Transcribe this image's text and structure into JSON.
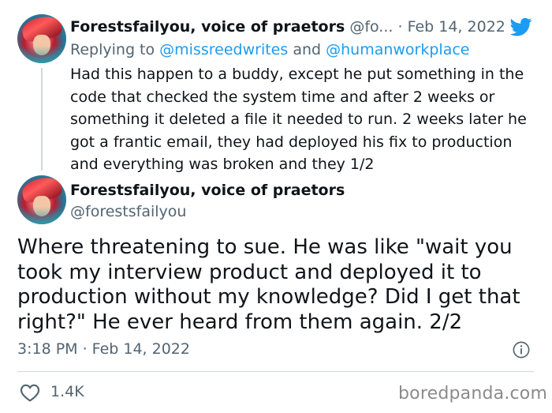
{
  "reply_tweet": {
    "display_name": "Forestsfailyou, voice of praetors",
    "handle_truncated": "@fo...",
    "separator": "·",
    "date": "Feb 14, 2022",
    "replying_prefix": "Replying to",
    "replying_user1": "@missreedwrites",
    "replying_and": "and",
    "replying_user2": "@humanworkplace",
    "text": "Had this happen to a buddy, except he put something in the code that checked the system time and after 2 weeks or something it deleted a file it needed to run. 2 weeks later he got a frantic email, they had deployed his fix to production and everything was broken and they 1/2"
  },
  "main_tweet": {
    "display_name": "Forestsfailyou, voice of praetors",
    "handle": "@forestsfailyou",
    "text": "Where threatening to sue. He was like \"wait you took my interview product and deployed it to production without my knowledge? Did I get that right?\" He ever heard from them again. 2/2",
    "timestamp": "3:18 PM · Feb 14, 2022",
    "likes": "1.4K"
  },
  "icons": {
    "brand": "twitter-bird-icon",
    "info": "info-icon",
    "like": "heart-icon"
  },
  "colors": {
    "twitter_blue": "#1d9bf0",
    "muted_text": "#536471",
    "primary_text": "#0f1419",
    "divider": "#cfd9de"
  },
  "watermark": "boredpanda.com"
}
